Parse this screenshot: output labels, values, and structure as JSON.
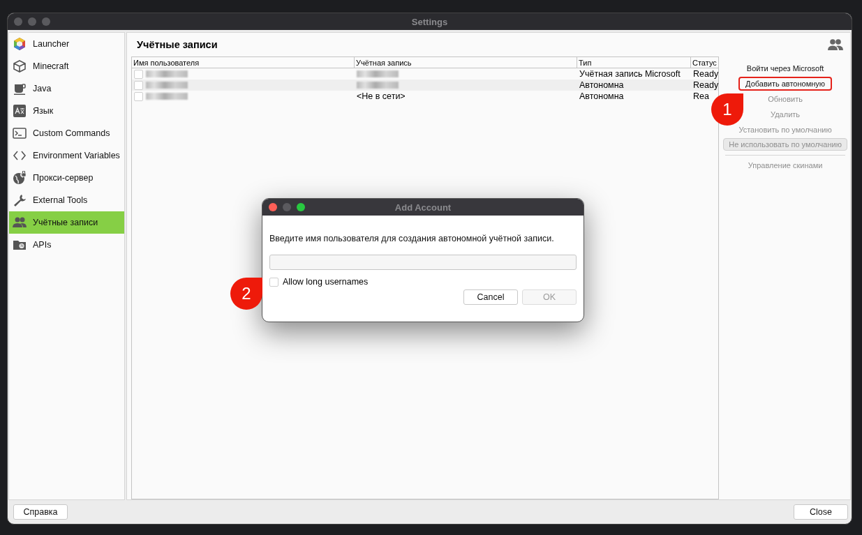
{
  "window": {
    "title": "Settings"
  },
  "sidebar": {
    "items": [
      {
        "label": "Launcher",
        "selected": false
      },
      {
        "label": "Minecraft",
        "selected": false
      },
      {
        "label": "Java",
        "selected": false
      },
      {
        "label": "Язык",
        "selected": false
      },
      {
        "label": "Custom Commands",
        "selected": false
      },
      {
        "label": "Environment Variables",
        "selected": false
      },
      {
        "label": "Прокси-сервер",
        "selected": false
      },
      {
        "label": "External Tools",
        "selected": false
      },
      {
        "label": "Учётные записи",
        "selected": true
      },
      {
        "label": "APIs",
        "selected": false
      }
    ]
  },
  "page": {
    "title": "Учётные записи"
  },
  "table": {
    "columns": [
      "Имя пользователя",
      "Учётная запись",
      "Тип",
      "Статус"
    ],
    "rows": [
      {
        "checked": false,
        "type": "Учётная запись Microsoft",
        "status": "Ready"
      },
      {
        "checked": false,
        "type": "Автономна",
        "status": "Ready"
      },
      {
        "checked": false,
        "account": "<Не в сети>",
        "type": "Автономна",
        "status": "Rea"
      }
    ]
  },
  "actions": [
    {
      "label": "Войти через Microsoft",
      "kind": "flat",
      "disabled": false,
      "highlighted": false
    },
    {
      "label": "Добавить автономную",
      "kind": "flat",
      "disabled": false,
      "highlighted": true
    },
    {
      "label": "Обновить",
      "kind": "flat",
      "disabled": true,
      "highlighted": false
    },
    {
      "label": "Удалить",
      "kind": "flat",
      "disabled": true,
      "highlighted": false
    },
    {
      "label": "Установить по умолчанию",
      "kind": "flat",
      "disabled": true,
      "highlighted": false
    },
    {
      "label": "Не использовать по умолчанию",
      "kind": "bordered",
      "disabled": true,
      "highlighted": false
    }
  ],
  "skin_actions": [
    {
      "label": "Управление скинами",
      "disabled": true,
      "highlighted": false
    }
  ],
  "help_button": "Справка",
  "close_button": "Close",
  "dialog": {
    "title": "Add Account",
    "prompt": "Введите имя пользователя для создания автономной учётной записи.",
    "checkbox": {
      "label": "Allow long usernames",
      "checked": false
    },
    "buttons": [
      {
        "label": "Cancel",
        "disabled": false
      },
      {
        "label": "OK",
        "disabled": true
      }
    ]
  },
  "annotations": [
    {
      "number": "1"
    },
    {
      "number": "2"
    }
  ]
}
